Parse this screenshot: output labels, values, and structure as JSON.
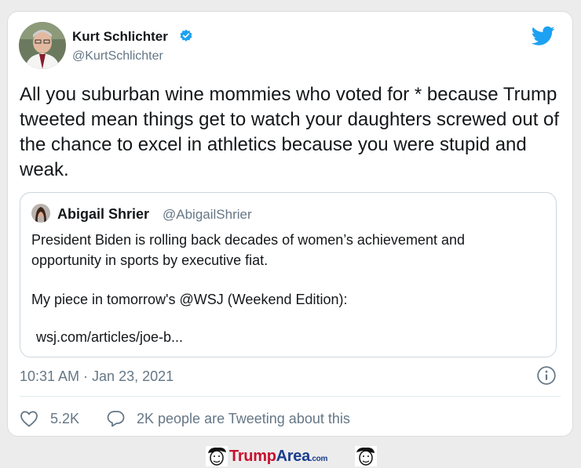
{
  "author": {
    "name": "Kurt Schlichter",
    "handle": "@KurtSchlichter",
    "avatar_icon": "author-avatar"
  },
  "tweet": {
    "text": "All you suburban wine mommies who voted for * because Trump tweeted mean things get to watch your daughters screwed out of the chance to excel in athletics because you were stupid and weak."
  },
  "quote": {
    "name": "Abigail Shrier",
    "handle": "@AbigailShrier",
    "paragraph1": "President Biden is rolling back decades of women’s achievement and opportunity in sports by executive fiat.",
    "paragraph2": "My piece in tomorrow's @WSJ (Weekend Edition):",
    "link": "wsj.com/articles/joe-b..."
  },
  "meta": {
    "timestamp": "10:31 AM · Jan 23, 2021",
    "likes": "5.2K",
    "discussion": "2K people are Tweeting about this"
  },
  "footer": {
    "logo_trump": "Trump",
    "logo_area": "Area",
    "logo_com": ".com"
  },
  "colors": {
    "twitter_blue": "#1da1f2",
    "secondary_text": "#657786",
    "brand_red": "#c8102e",
    "brand_blue": "#1b3d8f"
  }
}
